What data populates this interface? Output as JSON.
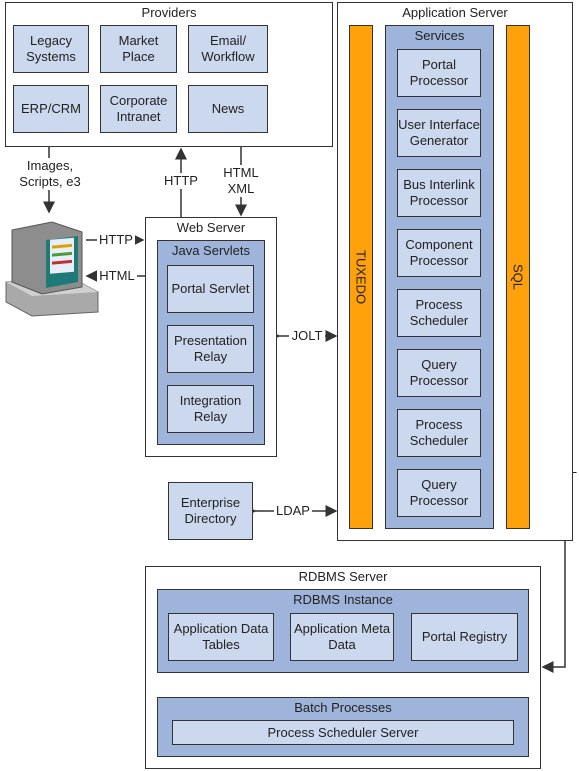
{
  "providers": {
    "title": "Providers",
    "items": [
      "Legacy Systems",
      "Market Place",
      "Email/ Workflow",
      "ERP/CRM",
      "Corporate Intranet",
      "News"
    ]
  },
  "labels": {
    "images": "Images, Scripts, e3",
    "http_up": "HTTP",
    "html_xml": "HTML XML",
    "http": "HTTP",
    "html": "HTML",
    "jolt": "JOLT",
    "ldap": "LDAP",
    "sql": "SQL"
  },
  "web_server": {
    "title": "Web Server",
    "servlets_title": "Java Servlets",
    "items": [
      "Portal Servlet",
      "Presentation Relay",
      "Integration Relay"
    ]
  },
  "enterprise_directory": "Enterprise Directory",
  "app_server": {
    "title": "Application Server",
    "tuxedo": "TUXEDO",
    "sql": "SQL",
    "services_title": "Services",
    "services": [
      "Portal Processor",
      "User Interface Generator",
      "Bus Interlink Processor",
      "Component Processor",
      "Process Scheduler",
      "Query Processor",
      "Process Scheduler",
      "Query Processor"
    ]
  },
  "rdbms": {
    "title": "RDBMS Server",
    "instance_title": "RDBMS Instance",
    "items": [
      "Application Data Tables",
      "Application Meta Data",
      "Portal Registry"
    ],
    "batch_title": "Batch Processes",
    "batch_item": "Process Scheduler Server"
  },
  "colors": {
    "outer": "#ffffff",
    "container": "#9fb4da",
    "box": "#cbd8ee",
    "bar": "#ffa10b"
  }
}
